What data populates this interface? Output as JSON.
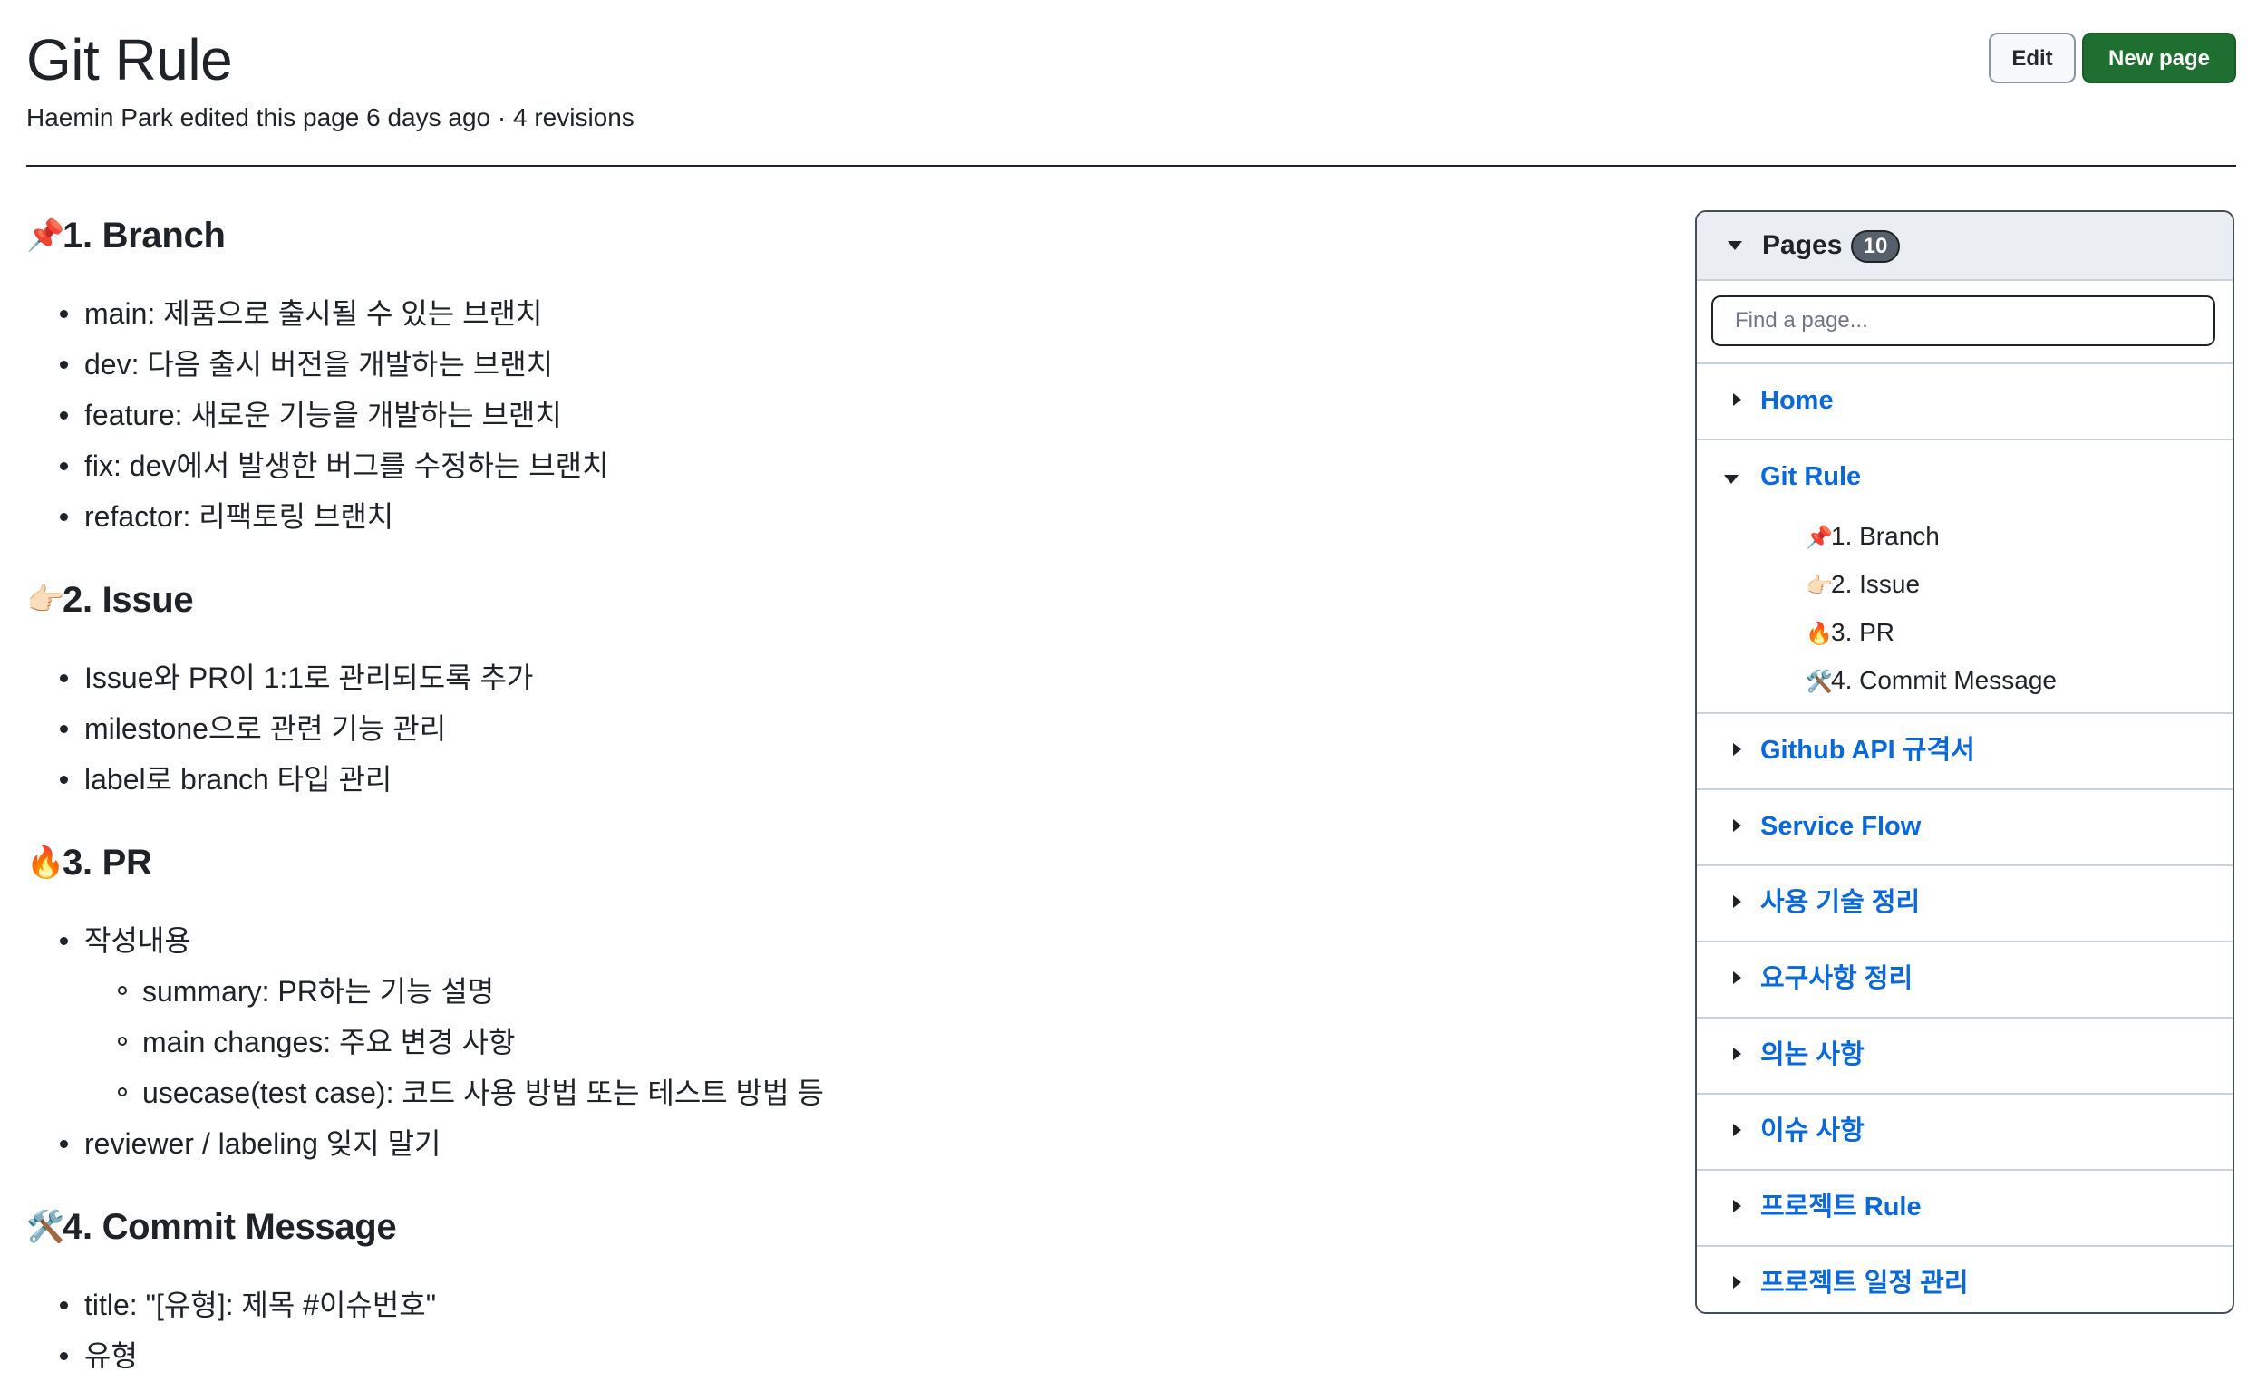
{
  "header": {
    "title": "Git Rule",
    "meta": "Haemin Park edited this page 6 days ago · 4 revisions",
    "edit_label": "Edit",
    "new_page_label": "New page"
  },
  "content": {
    "sections": [
      {
        "emoji": "📌",
        "heading": "1. Branch",
        "items": [
          "main: 제품으로 출시될 수 있는 브랜치",
          "dev: 다음 출시 버전을 개발하는 브랜치",
          "feature: 새로운 기능을 개발하는 브랜치",
          "fix: dev에서 발생한 버그를 수정하는 브랜치",
          "refactor: 리팩토링 브랜치"
        ]
      },
      {
        "emoji": "👉🏻",
        "heading": "2. Issue",
        "items": [
          "Issue와 PR이 1:1로 관리되도록 추가",
          "milestone으로 관련 기능 관리",
          "label로 branch 타입 관리"
        ]
      },
      {
        "emoji": "🔥",
        "heading": "3. PR",
        "items": [
          "작성내용",
          "reviewer / labeling 잊지 말기"
        ],
        "subitems": [
          "summary: PR하는 기능 설명",
          "main changes: 주요 변경 사항",
          "usecase(test case): 코드 사용 방법 또는 테스트 방법 등"
        ]
      },
      {
        "emoji": "🛠️",
        "heading": "4. Commit Message",
        "items": [
          "title: \"[유형]: 제목 #이슈번호\"",
          "유형"
        ]
      }
    ]
  },
  "sidebar": {
    "pages_label": "Pages",
    "pages_count": "10",
    "search_placeholder": "Find a page...",
    "pages": [
      "Home",
      "Git Rule",
      "Github API 규격서",
      "Service Flow",
      "사용 기술 정리",
      "요구사항 정리",
      "의논 사항",
      "이슈 사항",
      "프로젝트 Rule",
      "프로젝트 일정 관리"
    ],
    "git_rule_children": [
      {
        "emoji": "📌",
        "label": "1. Branch"
      },
      {
        "emoji": "👉🏻",
        "label": "2. Issue"
      },
      {
        "emoji": "🔥",
        "label": "3. PR"
      },
      {
        "emoji": "🛠️",
        "label": "4. Commit Message"
      }
    ]
  }
}
